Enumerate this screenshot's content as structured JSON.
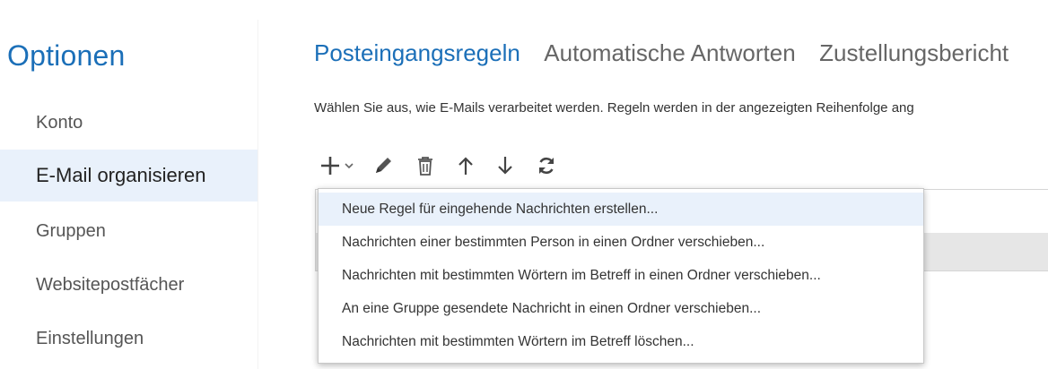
{
  "sidebar": {
    "title": "Optionen",
    "items": [
      {
        "label": "Konto",
        "selected": false
      },
      {
        "label": "E-Mail organisieren",
        "selected": true
      },
      {
        "label": "Gruppen",
        "selected": false
      },
      {
        "label": "Websitepostfächer",
        "selected": false
      },
      {
        "label": "Einstellungen",
        "selected": false
      }
    ]
  },
  "tabs": [
    {
      "label": "Posteingangsregeln",
      "active": true
    },
    {
      "label": "Automatische Antworten",
      "active": false
    },
    {
      "label": "Zustellungsbericht",
      "active": false
    }
  ],
  "description": "Wählen Sie aus, wie E-Mails verarbeitet werden. Regeln werden in der angezeigten Reihenfolge ang",
  "toolbar": {
    "icons": [
      "plus-icon",
      "chevron-down-icon",
      "pencil-icon",
      "trash-icon",
      "arrow-up-icon",
      "arrow-down-icon",
      "refresh-icon"
    ]
  },
  "menu": {
    "items": [
      "Neue Regel für eingehende Nachrichten erstellen...",
      "Nachrichten einer bestimmten Person in einen Ordner verschieben...",
      "Nachrichten mit bestimmten Wörtern im Betreff in einen Ordner verschieben...",
      "An eine Gruppe gesendete Nachricht in einen Ordner verschieben...",
      "Nachrichten mit bestimmten Wörtern im Betreff löschen..."
    ],
    "highlighted_index": 0
  },
  "colors": {
    "accent": "#1b6fb8",
    "selected_bg": "#e9f1fb"
  }
}
